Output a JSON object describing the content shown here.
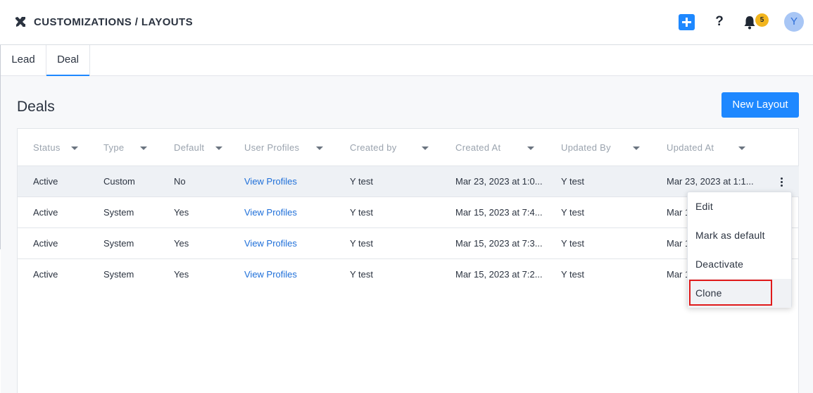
{
  "header": {
    "title": "CUSTOMIZATIONS / LAYOUTS",
    "help_label": "?",
    "notification_count": "5",
    "avatar_initial": "Y",
    "accent_color": "#1e88ff"
  },
  "tabs": [
    {
      "label": "Lead"
    },
    {
      "label": "Deal",
      "active": true
    }
  ],
  "main": {
    "section_title": "Deals",
    "new_layout_label": "New Layout"
  },
  "table": {
    "columns": [
      "Status",
      "Type",
      "Default",
      "User Profiles",
      "Created by",
      "Created At",
      "Updated By",
      "Updated At"
    ],
    "rows": [
      {
        "status": "Active",
        "type": "Custom",
        "default": "No",
        "profiles": "View Profiles",
        "created_by": "Y test",
        "created_at": "Mar 23, 2023 at 1:0...",
        "updated_by": "Y test",
        "updated_at": "Mar 23, 2023 at 1:1..."
      },
      {
        "status": "Active",
        "type": "System",
        "default": "Yes",
        "profiles": "View Profiles",
        "created_by": "Y test",
        "created_at": "Mar 15, 2023 at 7:4...",
        "updated_by": "Y test",
        "updated_at": "Mar 1"
      },
      {
        "status": "Active",
        "type": "System",
        "default": "Yes",
        "profiles": "View Profiles",
        "created_by": "Y test",
        "created_at": "Mar 15, 2023 at 7:3...",
        "updated_by": "Y test",
        "updated_at": "Mar 1"
      },
      {
        "status": "Active",
        "type": "System",
        "default": "Yes",
        "profiles": "View Profiles",
        "created_by": "Y test",
        "created_at": "Mar 15, 2023 at 7:2...",
        "updated_by": "Y test",
        "updated_at": "Mar 1"
      }
    ]
  },
  "row_menu": {
    "items": [
      "Edit",
      "Mark as default",
      "Deactivate",
      "Clone"
    ]
  }
}
